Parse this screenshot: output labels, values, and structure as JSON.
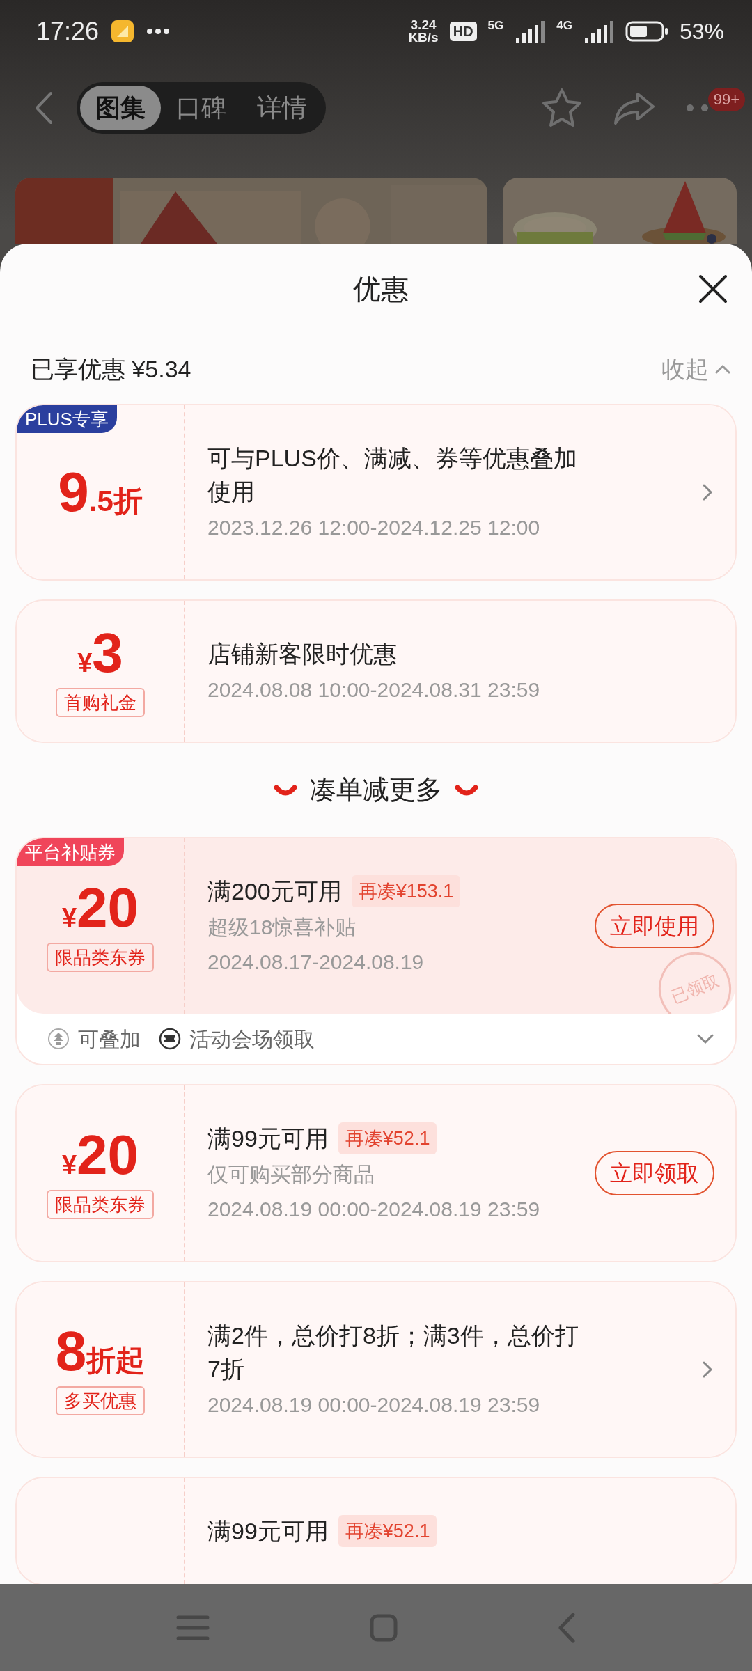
{
  "status_bar": {
    "time": "17:26",
    "speed": [
      "3.24",
      "KB/s"
    ],
    "hd": "HD",
    "net_1": "5G",
    "net_2": "4G",
    "battery": "53%"
  },
  "header": {
    "tabs": [
      {
        "label": "图集",
        "selected": true
      },
      {
        "label": "口碑",
        "selected": false
      },
      {
        "label": "详情",
        "selected": false
      }
    ],
    "badge": "99+"
  },
  "sheet": {
    "title": "优惠",
    "summary": "已享优惠 ¥5.34",
    "collapse": "收起"
  },
  "offers": [
    {
      "corner_tag": {
        "text": "PLUS专享",
        "color": "#2b3f9e"
      },
      "amount": {
        "value": "9",
        "suffix": ".5折"
      },
      "title": "可与PLUS价、满减、券等优惠叠加使用",
      "period": "2023.12.26 12:00-2024.12.25 12:00",
      "action": {
        "kind": "chevron"
      }
    },
    {
      "amount": {
        "prefix": "¥",
        "value": "3"
      },
      "label": "首购礼金",
      "title": "店铺新客限时优惠",
      "period": "2024.08.08 10:00-2024.08.31 23:59"
    }
  ],
  "more_section": {
    "title": "凑单减更多",
    "coupons": [
      {
        "corner_tag": {
          "text": "平台补贴券",
          "color": "#f0455a"
        },
        "amount": {
          "prefix": "¥",
          "value": "20"
        },
        "label": "限品类东券",
        "title": "满200元可用",
        "title_tag": "再凑¥153.1",
        "subtitle": "超级18惊喜补贴",
        "period": "2024.08.17-2024.08.19",
        "action": {
          "kind": "button",
          "text": "立即使用"
        },
        "stamp": "已领取",
        "footer": {
          "items": [
            {
              "kind": "stack",
              "text": "可叠加"
            },
            {
              "kind": "ticket",
              "text": "活动会场领取"
            }
          ],
          "expanded": false
        }
      },
      {
        "amount": {
          "prefix": "¥",
          "value": "20"
        },
        "label": "限品类东券",
        "title": "满99元可用",
        "title_tag": "再凑¥52.1",
        "subtitle": "仅可购买部分商品",
        "period": "2024.08.19 00:00-2024.08.19 23:59",
        "action": {
          "kind": "button",
          "text": "立即领取"
        }
      },
      {
        "amount": {
          "value": "8",
          "suffix": "折起"
        },
        "label": "多买优惠",
        "title": "满2件，总价打8折；满3件，总价打7折",
        "period": "2024.08.19 00:00-2024.08.19 23:59",
        "action": {
          "kind": "chevron"
        }
      },
      {
        "title": "满99元可用",
        "title_tag": "再凑¥52.1"
      }
    ]
  }
}
